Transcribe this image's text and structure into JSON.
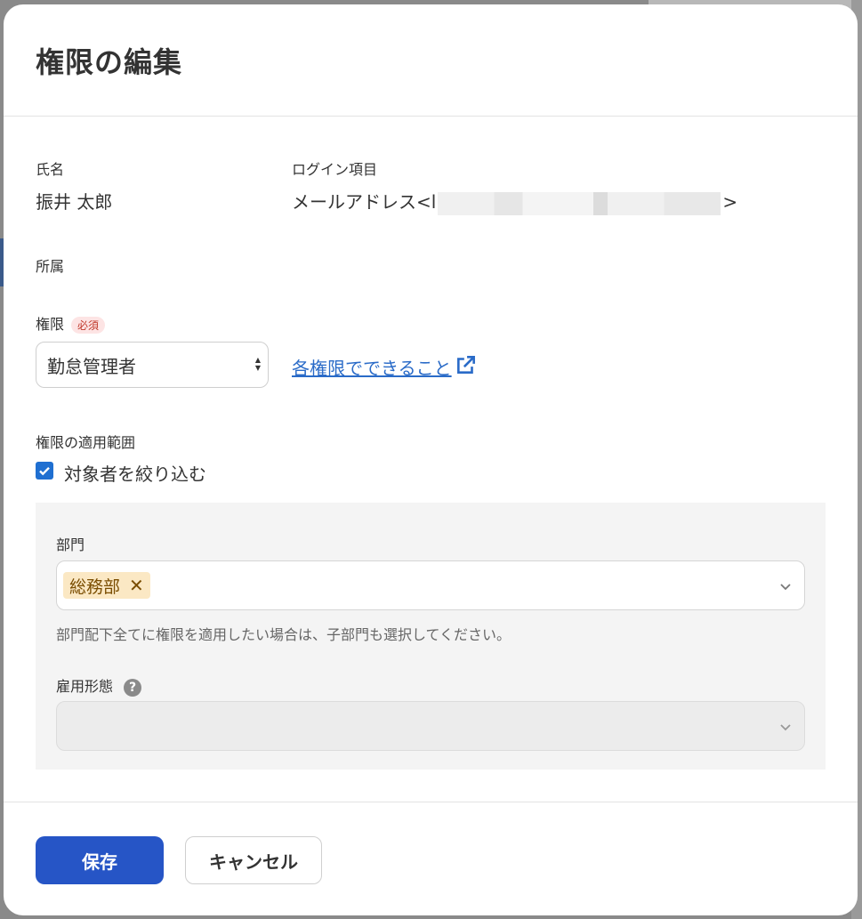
{
  "dialog": {
    "title": "権限の編集",
    "name_label": "氏名",
    "name_value": "振井 太郎",
    "login_label": "ログイン項目",
    "login_prefix": "メールアドレス<l",
    "login_suffix": ">",
    "affiliation_label": "所属",
    "permission_label": "権限",
    "required_badge": "必須",
    "permission_value": "勤怠管理者",
    "help_link": "各権限でできること",
    "scope_label": "権限の適用範囲",
    "narrow_checkbox_label": "対象者を絞り込む",
    "narrow_checked": true,
    "department_label": "部門",
    "department_tags": [
      "総務部"
    ],
    "department_hint": "部門配下全てに権限を適用したい場合は、子部門も選択してください。",
    "employment_label": "雇用形態",
    "employment_value": "",
    "save_button": "保存",
    "cancel_button": "キャンセル"
  },
  "colors": {
    "primary": "#2655c6",
    "link": "#2a6bc8",
    "tag_bg": "#fbe8c4",
    "required": "#c0392b"
  },
  "icons": {
    "external_link": "external-link-icon",
    "tag_remove": "close-icon",
    "dropdown": "chevron-down-icon",
    "help": "question-circle-icon"
  }
}
